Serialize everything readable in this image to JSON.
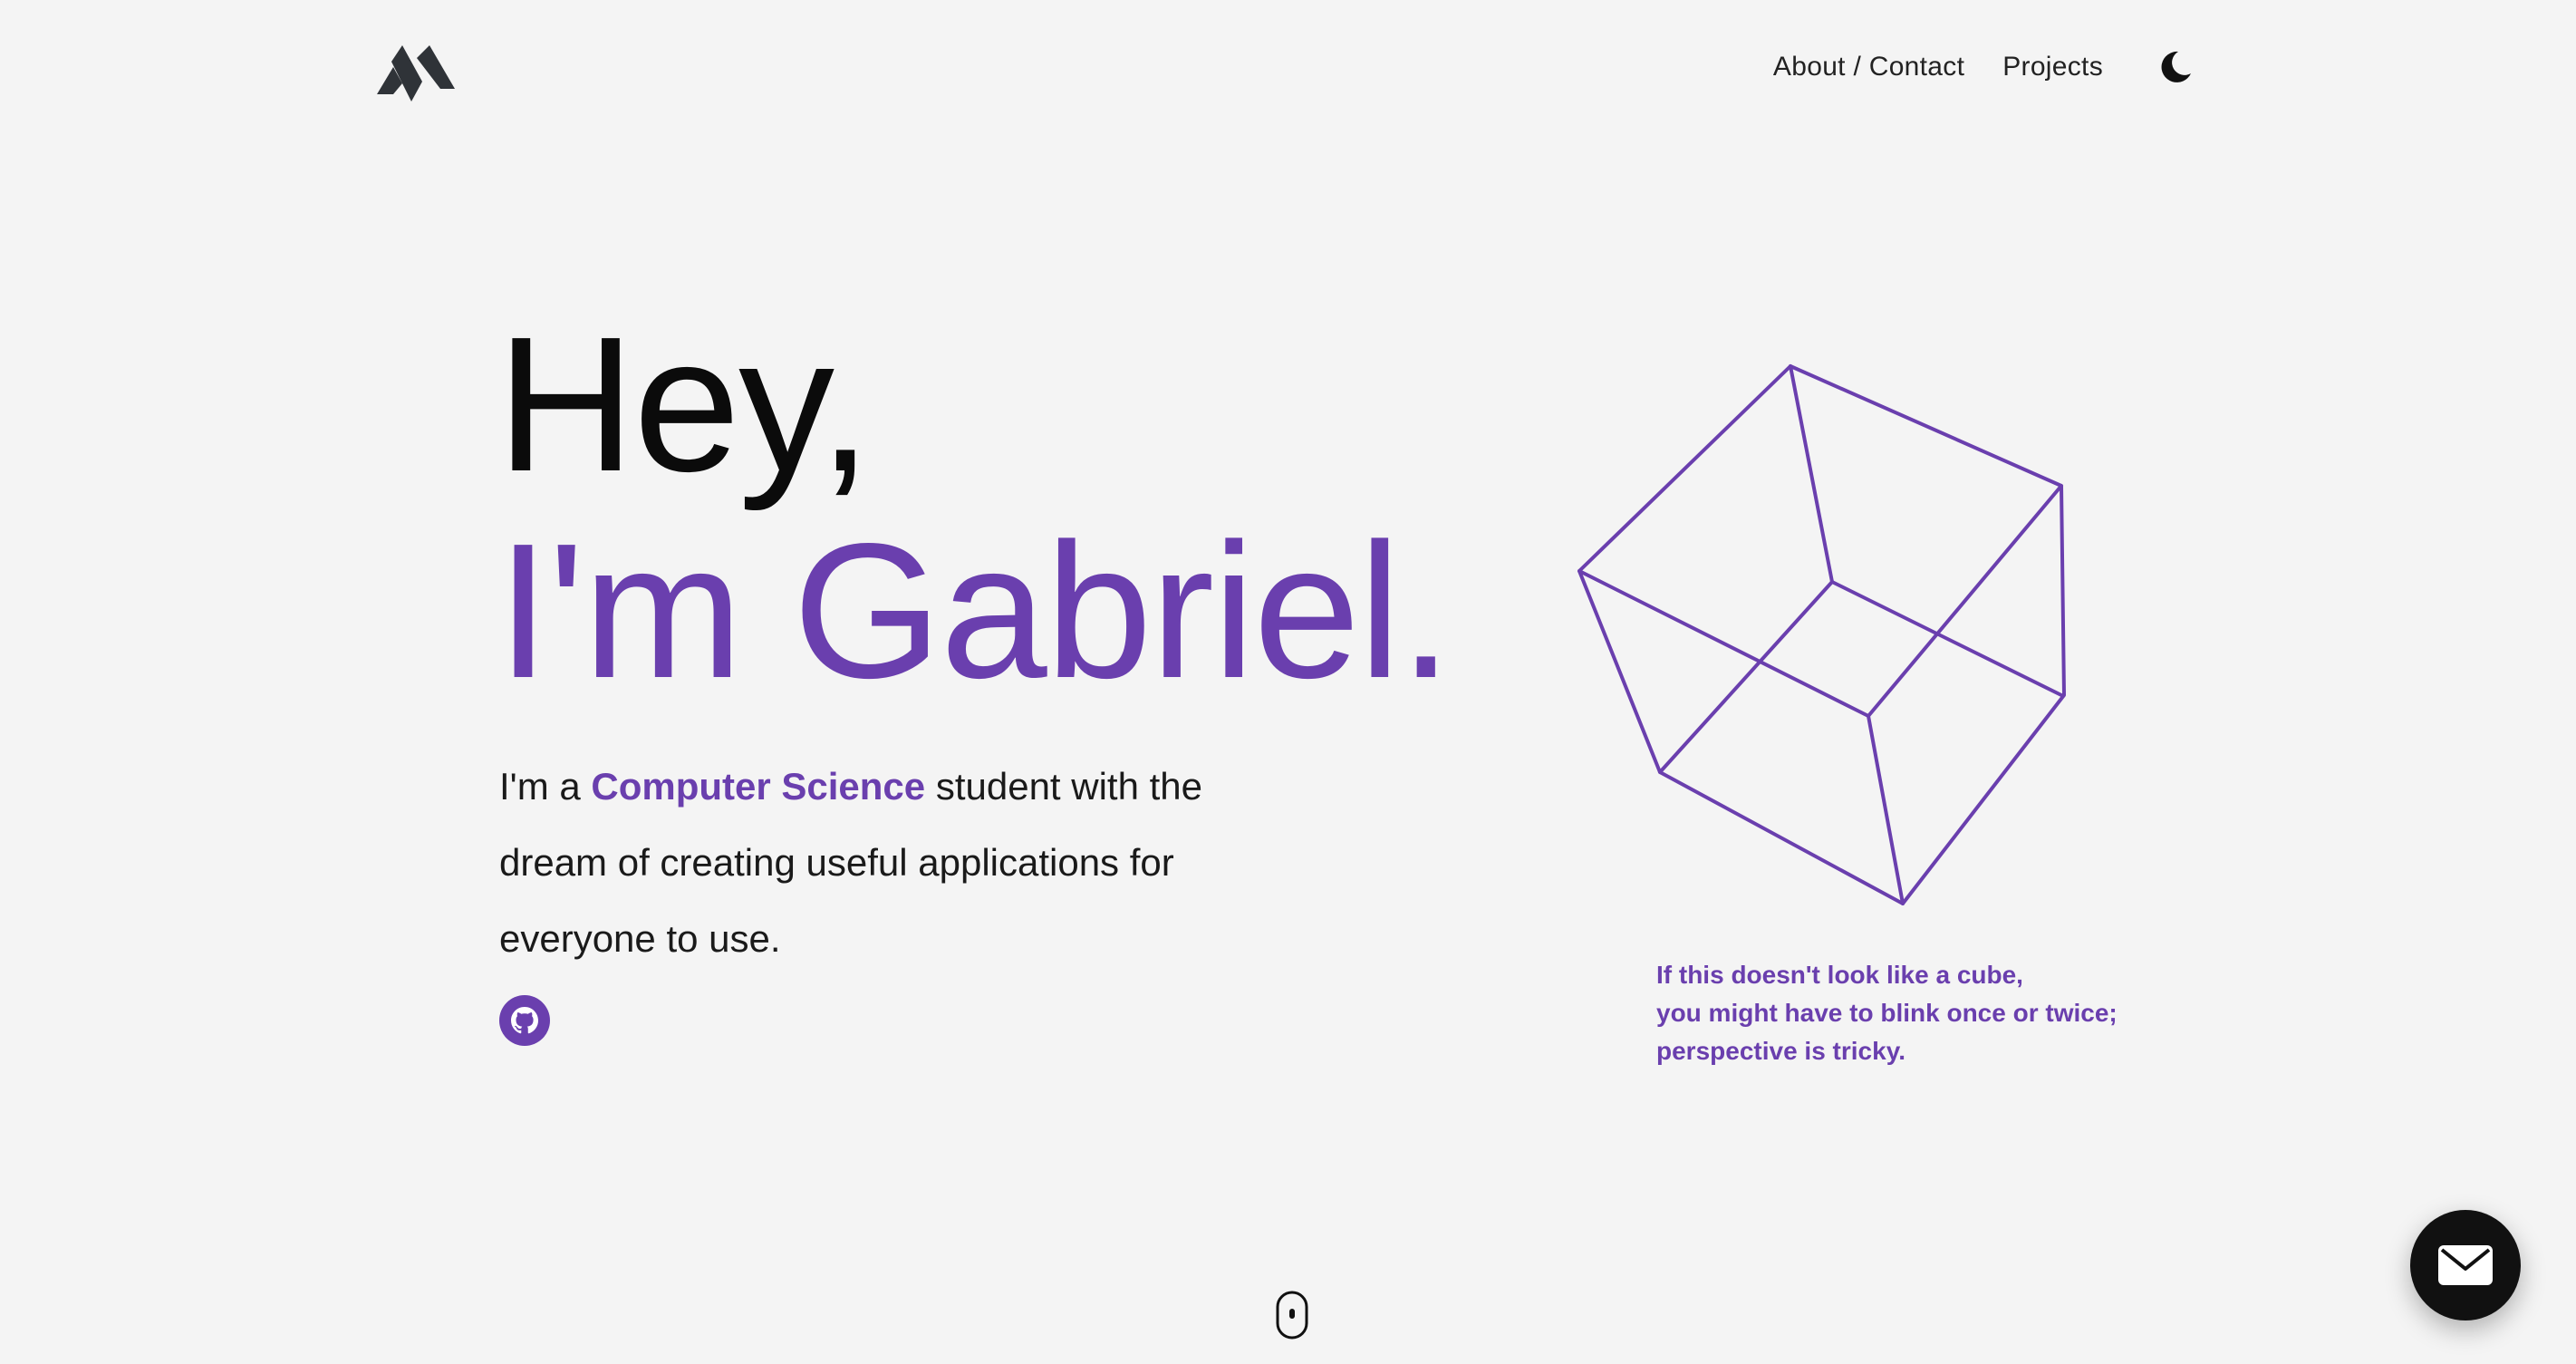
{
  "header": {
    "logo_icon": "mountain-logo-icon",
    "nav": [
      {
        "label": "About / Contact"
      },
      {
        "label": "Projects"
      }
    ],
    "theme_toggle_icon": "moon-icon"
  },
  "hero": {
    "line1": "Hey,",
    "line2": "I'm Gabriel.",
    "intro_prefix": "I'm a ",
    "intro_highlight": "Computer Science",
    "intro_suffix": " student with the dream of creating useful applications for everyone to use.",
    "github_icon": "github-icon"
  },
  "cube": {
    "caption_lines": [
      "If this doesn't look like a cube,",
      "you might have to blink once or twice;",
      "perspective is tricky."
    ]
  },
  "scroll_icon": "mouse-scroll-icon",
  "contact_icon": "envelope-icon",
  "colors": {
    "accent": "#6a3fae",
    "background": "#f4f4f4",
    "text": "#111111"
  }
}
